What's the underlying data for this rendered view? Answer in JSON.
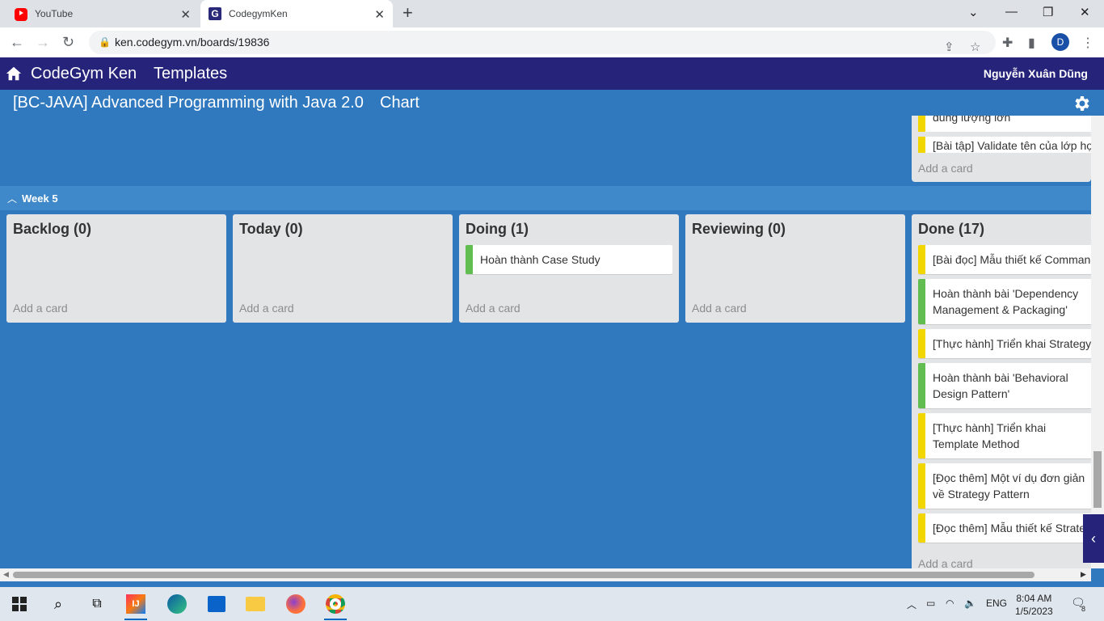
{
  "browser": {
    "tabs": [
      {
        "title": "YouTube",
        "active": false
      },
      {
        "title": "CodegymKen",
        "active": true
      }
    ],
    "url": "ken.codegym.vn/boards/19836",
    "profile_initial": "D"
  },
  "app": {
    "brand": "CodeGym Ken",
    "templates": "Templates",
    "user": "Nguyễn Xuân Dũng"
  },
  "board": {
    "title": "[BC-JAVA] Advanced Programming with Java 2.0",
    "chart": "Chart"
  },
  "prev_done": {
    "cards": [
      "dung lượng lớn",
      "[Bài tập] Validate tên của lớp học"
    ],
    "add_card": "Add a card"
  },
  "week": {
    "label": "Week 5"
  },
  "lists": {
    "backlog": {
      "title": "Backlog (0)",
      "add_card": "Add a card"
    },
    "today": {
      "title": "Today (0)",
      "add_card": "Add a card"
    },
    "doing": {
      "title": "Doing (1)",
      "add_card": "Add a card",
      "cards": [
        "Hoàn thành Case Study"
      ]
    },
    "reviewing": {
      "title": "Reviewing (0)",
      "add_card": "Add a card"
    },
    "done": {
      "title": "Done (17)",
      "add_card": "Add a card",
      "cards": [
        "[Bài đọc] Mẫu thiết kế Command",
        "Hoàn thành bài 'Dependency Management & Packaging'",
        "[Thực hành] Triển khai Strategy",
        "Hoàn thành bài 'Behavioral Design Pattern'",
        "[Thực hành] Triển khai Template Method",
        "[Đọc thêm] Một ví dụ đơn giản về Strategy Pattern",
        "[Đọc thêm] Mẫu thiết kế Strategy"
      ]
    }
  },
  "taskbar": {
    "lang": "ENG",
    "time": "8:04 AM",
    "date": "1/5/2023",
    "notifications": "8"
  },
  "colors": {
    "board_bg": "#3079bf",
    "header_bg": "#26237b",
    "label_green": "#61bd4f",
    "label_yellow": "#f2d600"
  }
}
